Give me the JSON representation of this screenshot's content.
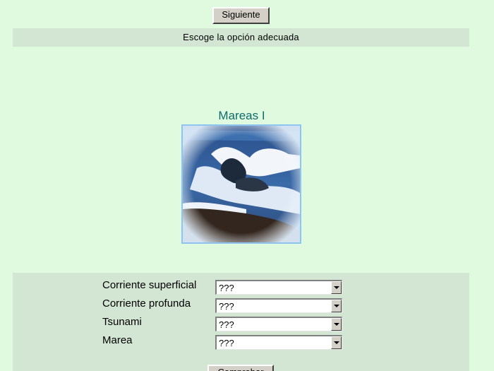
{
  "toolbar": {
    "next_label": "Siguiente"
  },
  "instruction": "Escoge la opción adecuada",
  "exercise": {
    "title": "Mareas I",
    "image_icon": "ocean-waves-photo"
  },
  "form": {
    "rows": [
      {
        "label": "Corriente superficial",
        "value": "???"
      },
      {
        "label": "Corriente profunda",
        "value": "???"
      },
      {
        "label": "Tsunami",
        "value": "???"
      },
      {
        "label": "Marea",
        "value": "???"
      }
    ],
    "check_label": "Comprobar"
  },
  "colors": {
    "background": "#e0fae0",
    "panel": "#d3e6d3",
    "title": "#0e6b6b"
  }
}
